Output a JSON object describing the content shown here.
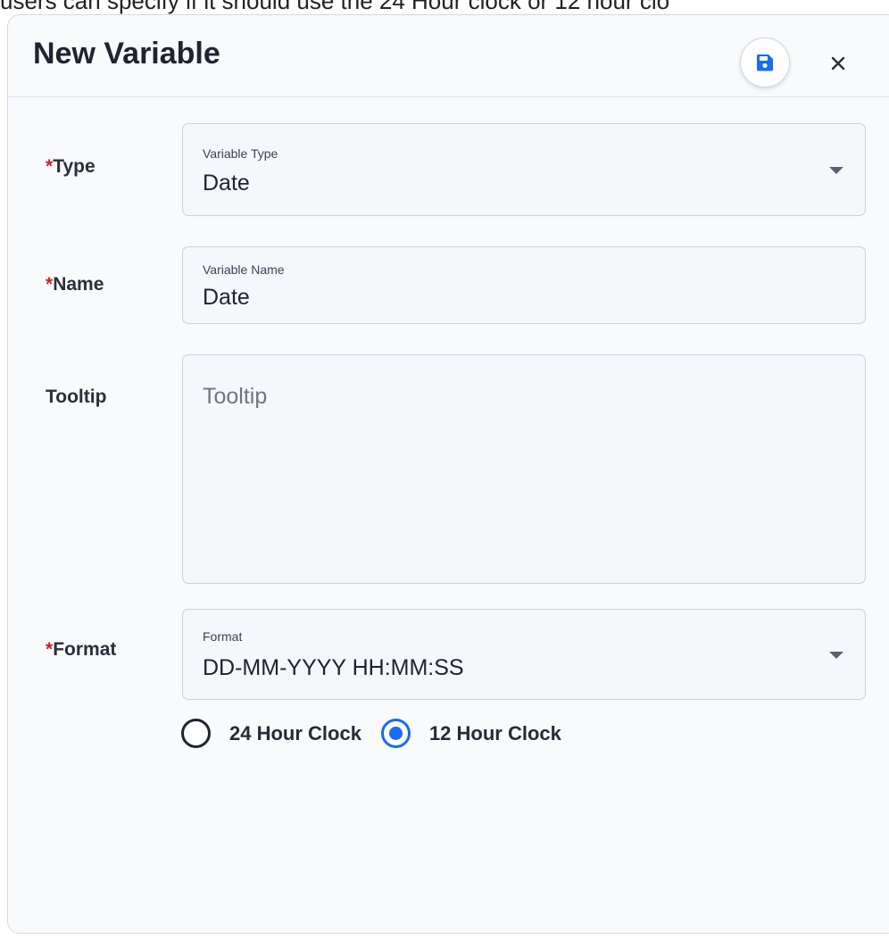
{
  "background": {
    "partial_text": "users can specify if it should use the 24 Hour clock or 12 hour clo"
  },
  "dialog": {
    "title": "New Variable",
    "save_icon": "floppy-disk-icon",
    "close_icon": "close-icon",
    "close_glyph": "×"
  },
  "fields": {
    "type": {
      "required_mark": "*",
      "label": "Type",
      "floating_label": "Variable Type",
      "value": "Date"
    },
    "name": {
      "required_mark": "*",
      "label": "Name",
      "floating_label": "Variable Name",
      "value": "Date"
    },
    "tooltip": {
      "label": "Tooltip",
      "placeholder": "Tooltip"
    },
    "format": {
      "required_mark": "*",
      "label": "Format",
      "floating_label": "Format",
      "value": "DD-MM-YYYY HH:MM:SS"
    }
  },
  "clock_options": [
    {
      "label": "24 Hour Clock",
      "selected": false
    },
    {
      "label": "12 Hour Clock",
      "selected": true
    }
  ],
  "colors": {
    "accent": "#1a6cf0",
    "required": "#c0262d"
  }
}
